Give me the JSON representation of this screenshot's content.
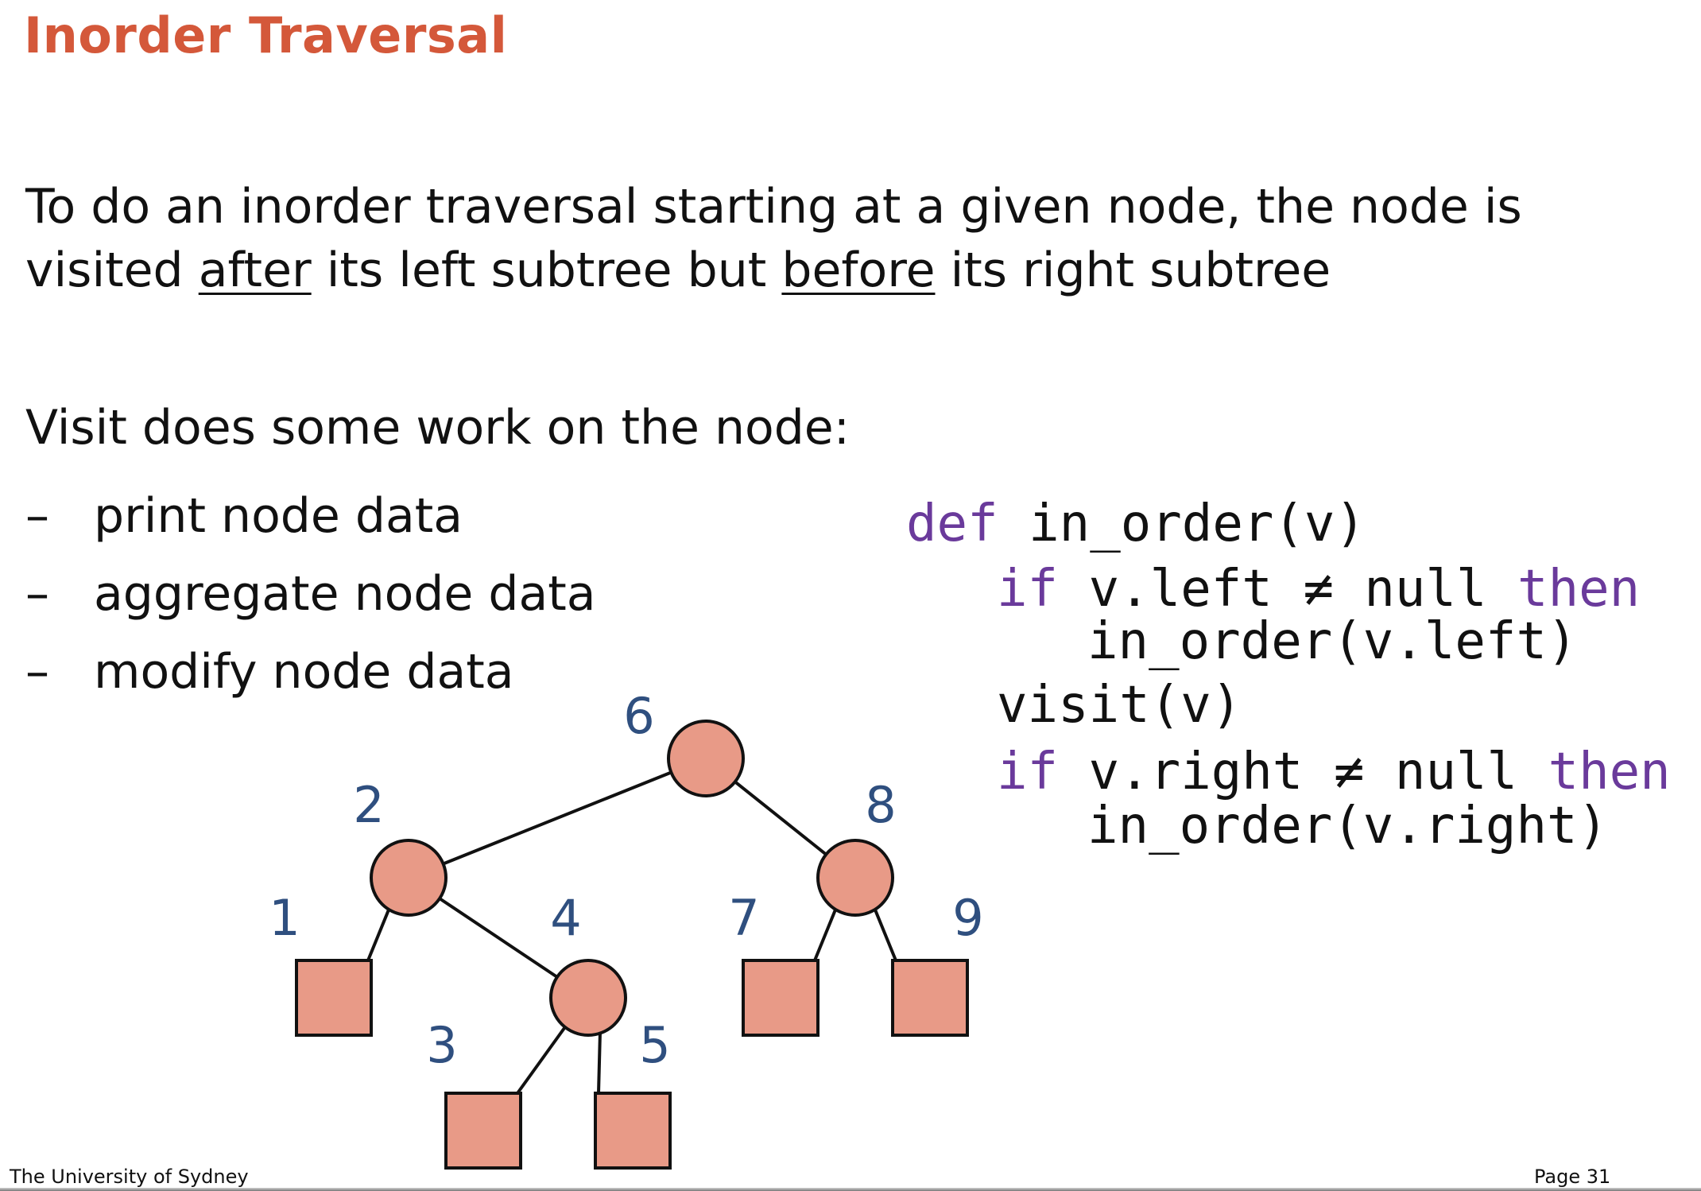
{
  "title": "Inorder Traversal",
  "intro": {
    "line1": "To do an inorder traversal starting at a given node, the node is",
    "line2_pre": "visited ",
    "line2_u1": "after",
    "line2_mid": " its left subtree but ",
    "line2_u2": "before",
    "line2_post": " its right subtree"
  },
  "visit_heading": "Visit does some work on the node:",
  "bullets": [
    {
      "dash": "–",
      "text": "print node data"
    },
    {
      "dash": "–",
      "text": "aggregate node data"
    },
    {
      "dash": "–",
      "text": "modify node data"
    }
  ],
  "code": {
    "l1_kw": "def",
    "l1_rest": " in_order(v)",
    "l2_kw": "if",
    "l2_mid": " v.left ≠ null ",
    "l2_kw2": "then",
    "l3": "in_order(v.left)",
    "l4": "visit(v)",
    "l5_kw": "if",
    "l5_mid": " v.right ≠ null ",
    "l5_kw2": "then",
    "l6": "in_order(v.right)"
  },
  "tree": {
    "node_color": "#e89a87",
    "label_color": "#2f4f7f",
    "nodes": [
      {
        "id": "6",
        "label": "6",
        "kind": "internal"
      },
      {
        "id": "2",
        "label": "2",
        "kind": "internal"
      },
      {
        "id": "8",
        "label": "8",
        "kind": "internal"
      },
      {
        "id": "1",
        "label": "1",
        "kind": "leaf"
      },
      {
        "id": "4",
        "label": "4",
        "kind": "internal"
      },
      {
        "id": "7",
        "label": "7",
        "kind": "leaf"
      },
      {
        "id": "9",
        "label": "9",
        "kind": "leaf"
      },
      {
        "id": "3",
        "label": "3",
        "kind": "leaf"
      },
      {
        "id": "5",
        "label": "5",
        "kind": "leaf"
      }
    ],
    "edges": [
      [
        "6",
        "2"
      ],
      [
        "6",
        "8"
      ],
      [
        "2",
        "1"
      ],
      [
        "2",
        "4"
      ],
      [
        "8",
        "7"
      ],
      [
        "8",
        "9"
      ],
      [
        "4",
        "3"
      ],
      [
        "4",
        "5"
      ]
    ]
  },
  "footer": {
    "institution": "The University of Sydney",
    "page": "Page 31"
  }
}
